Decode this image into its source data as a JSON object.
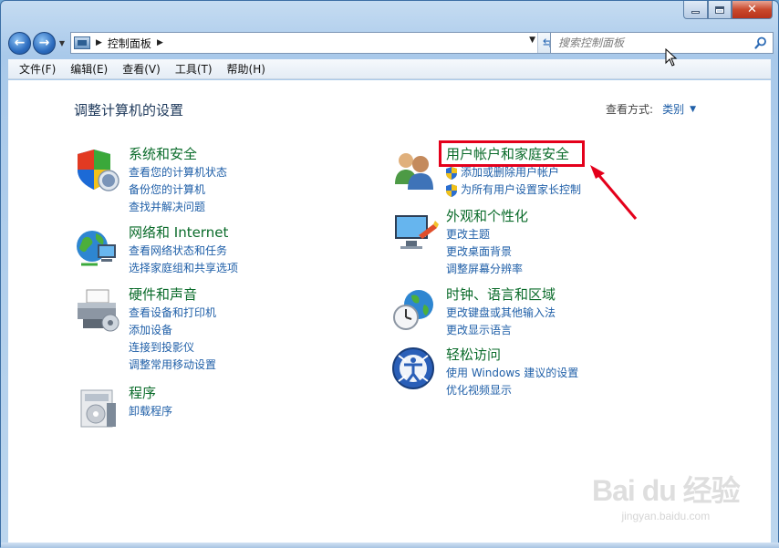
{
  "address": {
    "path_label": "控制面板"
  },
  "search": {
    "placeholder": "搜索控制面板"
  },
  "menu": [
    "文件(F)",
    "编辑(E)",
    "查看(V)",
    "工具(T)",
    "帮助(H)"
  ],
  "page": {
    "title": "调整计算机的设置",
    "view_by_label": "查看方式:",
    "view_by_value": "类别"
  },
  "categories": {
    "system": {
      "title": "系统和安全",
      "links": [
        "查看您的计算机状态",
        "备份您的计算机",
        "查找并解决问题"
      ]
    },
    "network": {
      "title": "网络和 Internet",
      "links": [
        "查看网络状态和任务",
        "选择家庭组和共享选项"
      ]
    },
    "hardware": {
      "title": "硬件和声音",
      "links": [
        "查看设备和打印机",
        "添加设备",
        "连接到投影仪",
        "调整常用移动设置"
      ]
    },
    "programs": {
      "title": "程序",
      "links": [
        "卸载程序"
      ]
    },
    "users": {
      "title": "用户帐户和家庭安全",
      "links": [
        "添加或删除用户帐户",
        "为所有用户设置家长控制"
      ]
    },
    "appearance": {
      "title": "外观和个性化",
      "links": [
        "更改主题",
        "更改桌面背景",
        "调整屏幕分辨率"
      ]
    },
    "clock": {
      "title": "时钟、语言和区域",
      "links": [
        "更改键盘或其他输入法",
        "更改显示语言"
      ]
    },
    "ease": {
      "title": "轻松访问",
      "links": [
        "使用 Windows 建议的设置",
        "优化视频显示"
      ]
    }
  },
  "watermark": {
    "logo": "Bai du 经验",
    "url": "jingyan.baidu.com"
  },
  "colors": {
    "link": "#1f5fa8",
    "category_title": "#0a6b2a",
    "highlight": "#e4001b"
  }
}
